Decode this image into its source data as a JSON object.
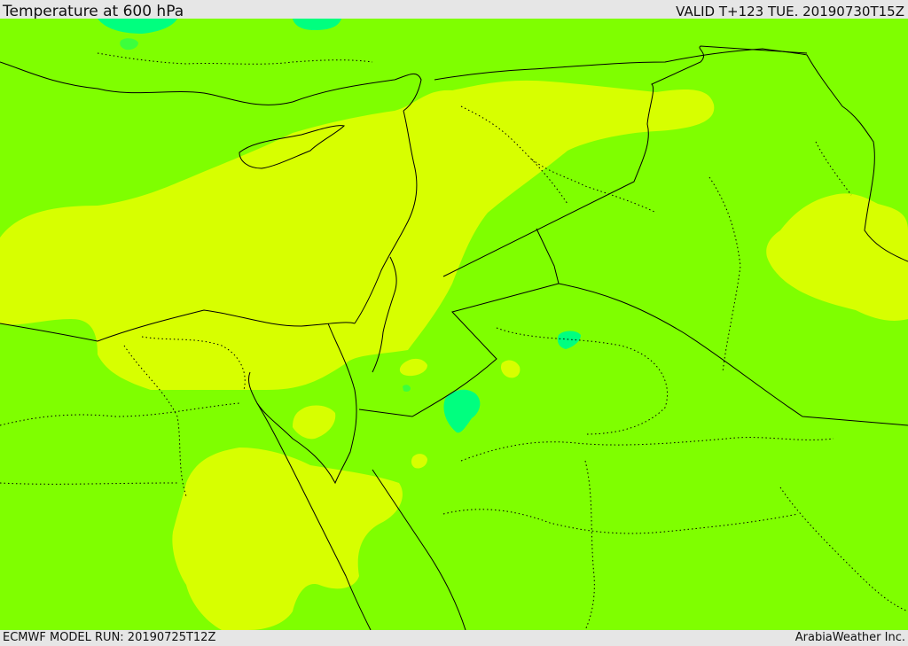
{
  "header": {
    "title": "Temperature at 600 hPa",
    "valid_time": "VALID T+123 TUE. 20190730T15Z"
  },
  "footer": {
    "model_run": "ECMWF MODEL RUN: 20190725T12Z",
    "credit": "ArabiaWeather Inc."
  },
  "map": {
    "colors": {
      "base_band": "#7fff00",
      "warmer_band": "#d7ff00",
      "cooler_band": "#00ff7f",
      "mid_band": "#3cff3c",
      "borders": "#000000"
    }
  }
}
